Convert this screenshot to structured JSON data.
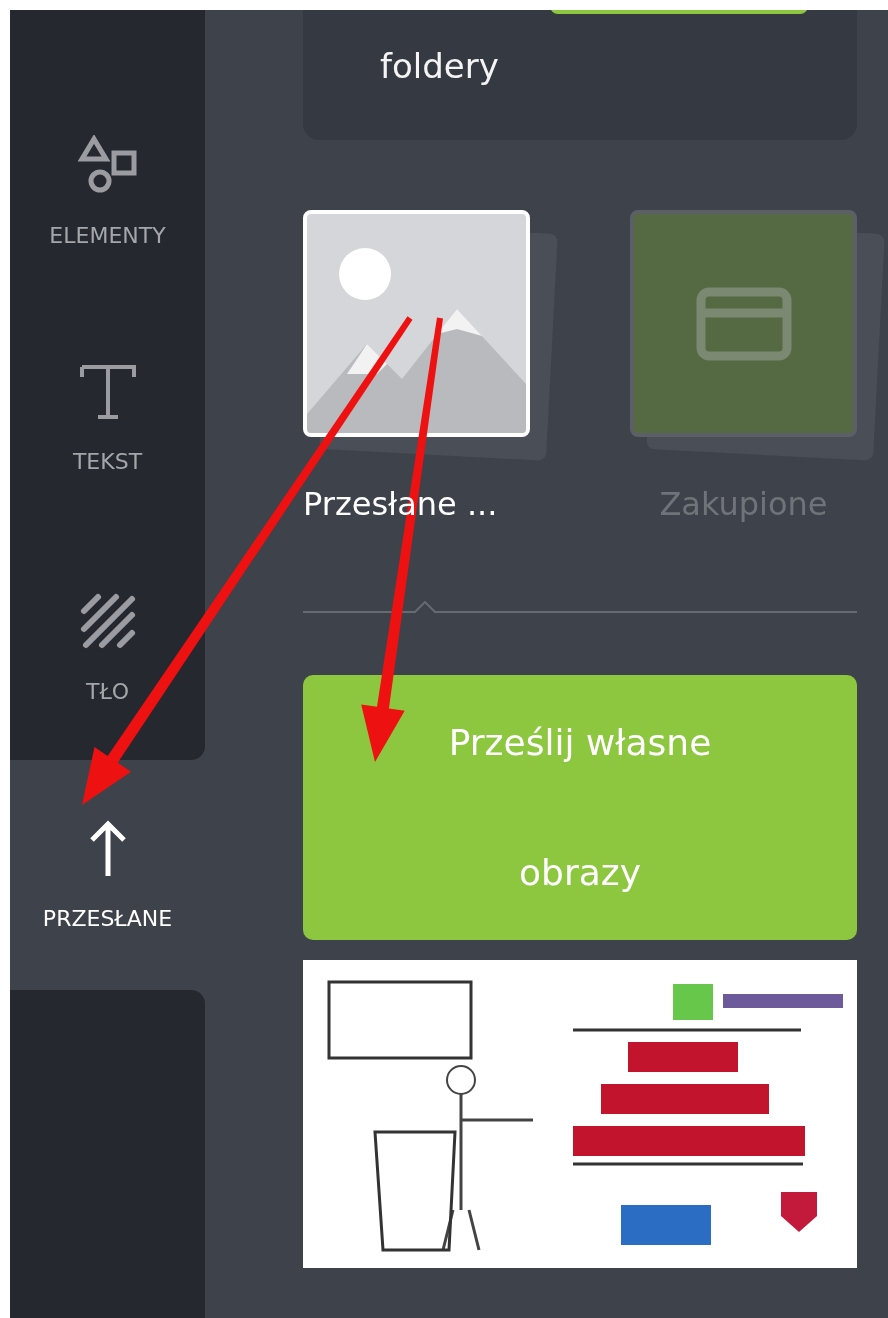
{
  "sidebar": {
    "items": [
      {
        "label": "ELEMENTY",
        "kind": "elements",
        "selected": false
      },
      {
        "label": "TEKST",
        "kind": "text",
        "selected": false
      },
      {
        "label": "TŁO",
        "kind": "background",
        "selected": false
      },
      {
        "label": "PRZESŁANE",
        "kind": "uploads",
        "selected": true
      }
    ]
  },
  "promo_card": {
    "text": "foldery",
    "button_visible": true
  },
  "folders": [
    {
      "label": "Przesłane ...",
      "kind": "uploads",
      "disabled": false
    },
    {
      "label": "Zakupione",
      "kind": "purchased",
      "disabled": true
    }
  ],
  "upload_button": "Prześlij własne obrazy",
  "annotations": [
    {
      "kind": "arrow"
    },
    {
      "kind": "arrow"
    }
  ]
}
